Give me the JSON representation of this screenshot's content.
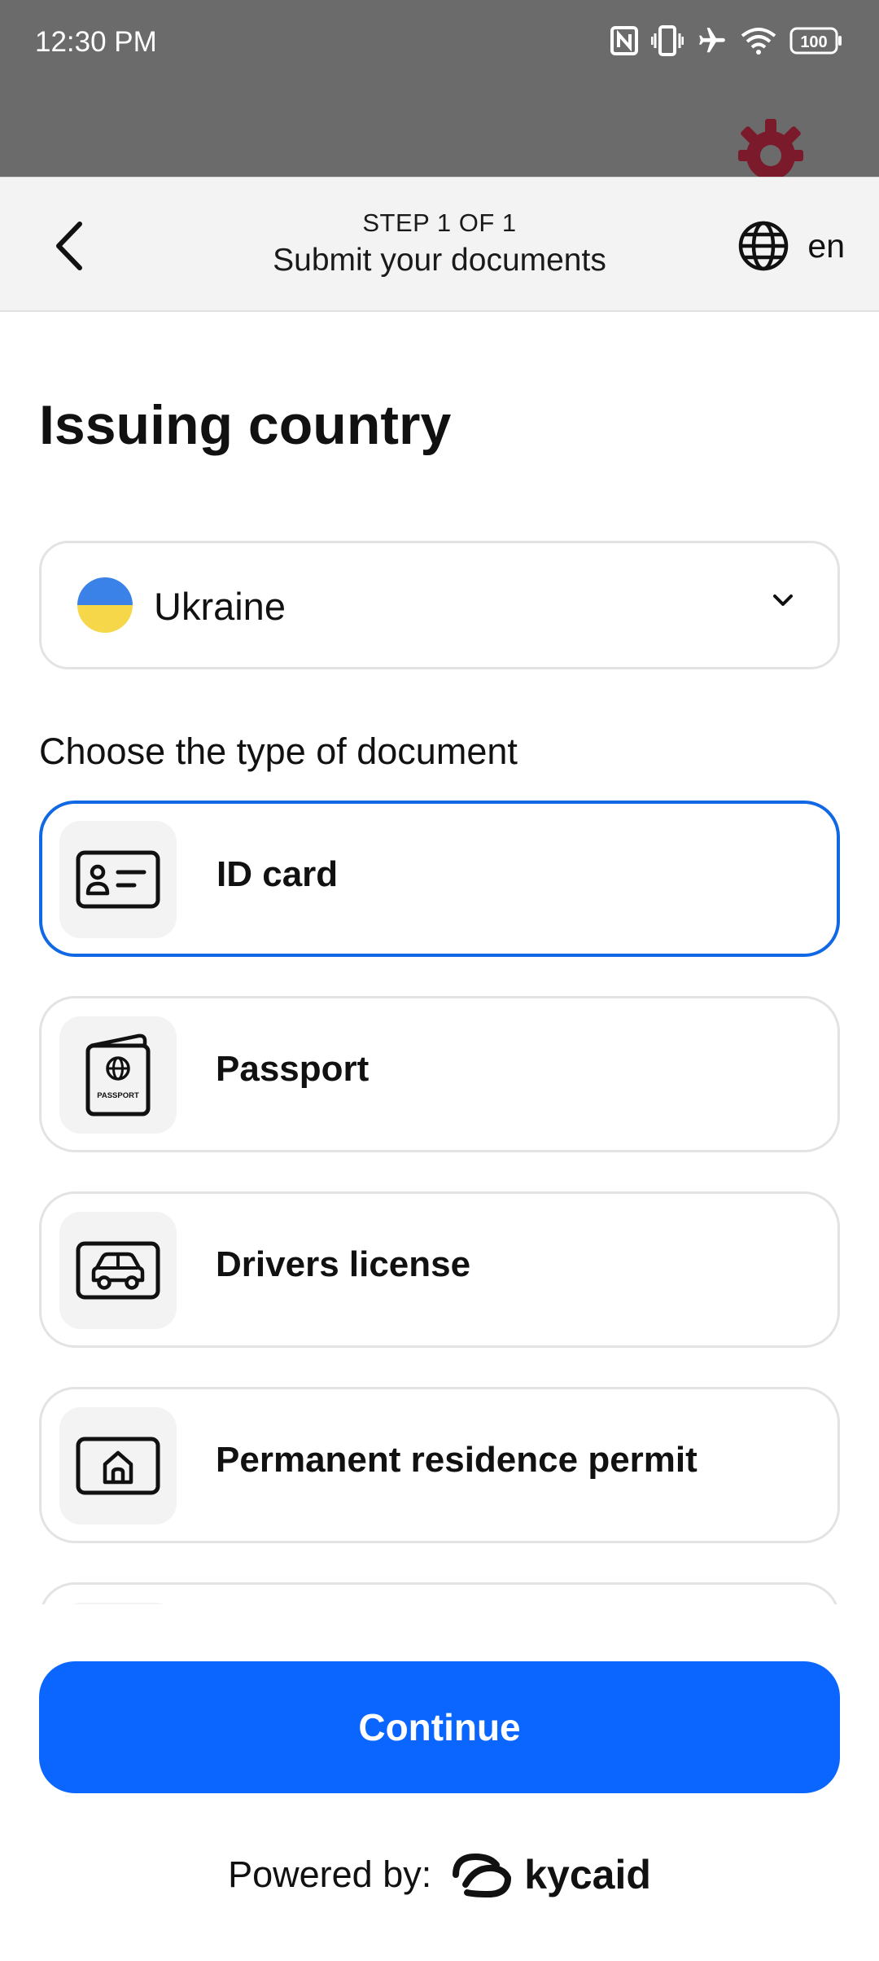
{
  "status_bar": {
    "time": "12:30 PM",
    "battery": "100"
  },
  "header": {
    "step": "STEP 1 OF 1",
    "title": "Submit your documents",
    "language": "en"
  },
  "page_title": "Issuing country",
  "country_select": {
    "value": "Ukraine",
    "flag_colors": [
      "#3b82e8",
      "#f6d74a"
    ]
  },
  "documents": {
    "label": "Choose the type of document",
    "items": [
      {
        "label": "ID card",
        "icon": "id-card-icon",
        "selected": true
      },
      {
        "label": "Passport",
        "icon": "passport-icon",
        "selected": false
      },
      {
        "label": "Drivers license",
        "icon": "car-icon",
        "selected": false
      },
      {
        "label": "Permanent residence permit",
        "icon": "house-icon",
        "selected": false
      }
    ],
    "passport_icon_text": "PASSPORT"
  },
  "continue_label": "Continue",
  "footer": {
    "powered_by": "Powered by:",
    "brand": "kycaid"
  },
  "colors": {
    "accent": "#0a66ff",
    "selected_border": "#1168e4",
    "status_bar": "#6b6b6b"
  }
}
